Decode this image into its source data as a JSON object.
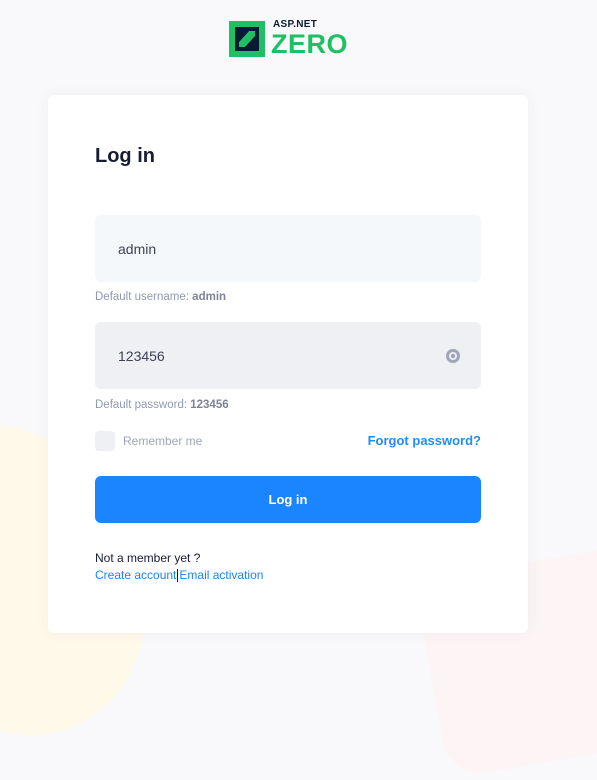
{
  "brand": {
    "small_text": "ASP.NET",
    "big_text": "ZERO",
    "logo_icon": "aspnetzero-logo-icon",
    "colors": {
      "green": "#1fbf63",
      "dark": "#0a1a33"
    }
  },
  "login": {
    "title": "Log in",
    "username": {
      "value": "admin",
      "placeholder": ""
    },
    "username_hint": {
      "prefix": "Default username: ",
      "value": "admin"
    },
    "password": {
      "value": "123456",
      "placeholder": ""
    },
    "password_hint": {
      "prefix": "Default password: ",
      "value": "123456"
    },
    "password_toggle_icon": "eye-icon",
    "remember_label": "Remember me",
    "forgot_label": "Forgot password?",
    "submit_label": "Log in"
  },
  "footer": {
    "member_text": "Not a member yet ?",
    "create_account": "Create account",
    "email_activation": "Email activation"
  },
  "colors": {
    "accent": "#1b84ff",
    "link": "#1f8ef1",
    "input_bg": "#f5f8fa",
    "title": "#181c32"
  }
}
